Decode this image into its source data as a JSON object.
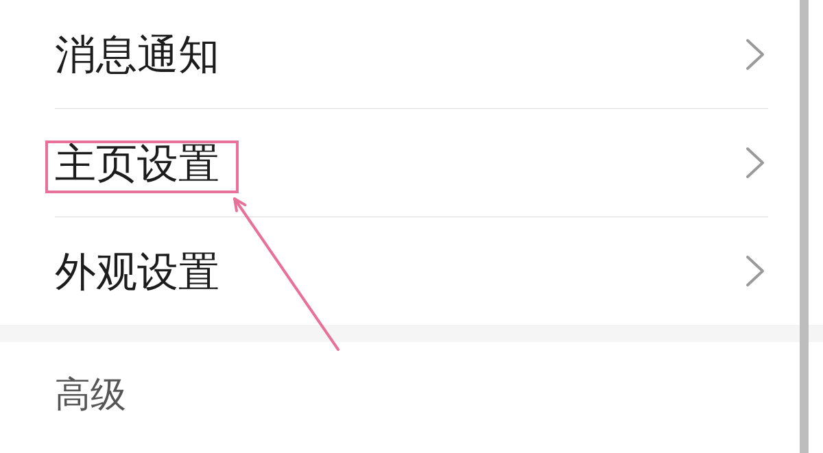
{
  "settings_list": {
    "items": [
      {
        "label": "消息通知",
        "highlighted": false
      },
      {
        "label": "主页设置",
        "highlighted": true
      },
      {
        "label": "外观设置",
        "highlighted": false
      }
    ]
  },
  "section_header": {
    "label": "高级"
  }
}
